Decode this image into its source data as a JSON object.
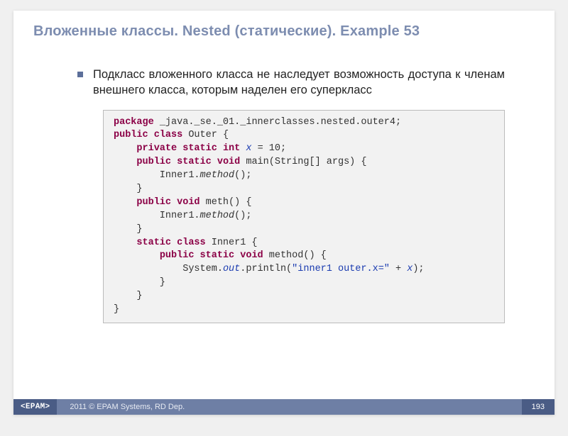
{
  "title": "Вложенные классы. Nested (статические). Example 53",
  "bullet": "Подкласс вложенного класса не наследует возможность доступа к членам внешнего класса, которым наделен его суперкласс",
  "code": {
    "pkg_kw": "package",
    "pkg_val": " _java._se._01._innerclasses.nested.outer4;",
    "pub": "public",
    "cls": "class",
    "outer": " Outer {",
    "priv": "private",
    "stat": "static",
    "int_kw": "int",
    "x_decl": "x",
    "x_init": " = 10;",
    "void_kw": "void",
    "main_sig": " main(String[] args) {",
    "inner_call_pre": "        Inner1.",
    "method_name": "method",
    "call_end": "();",
    "brace_close": "    }",
    "meth_sig": " meth() {",
    "inner_kw": "static class",
    "inner_name": " Inner1 {",
    "method_sig": " method() {",
    "sysout_pre": "            System.",
    "out_field": "out",
    "println_pre": ".println(",
    "str_literal": "\"inner1 outer.x=\"",
    "plus": " + ",
    "x_ref": "x",
    "println_end": ");",
    "brace8": "        }",
    "brace4": "    }",
    "brace0": "}"
  },
  "footer": {
    "logo": "<EPAM>",
    "copyright": "2011 © EPAM Systems, RD Dep.",
    "page": "193"
  }
}
